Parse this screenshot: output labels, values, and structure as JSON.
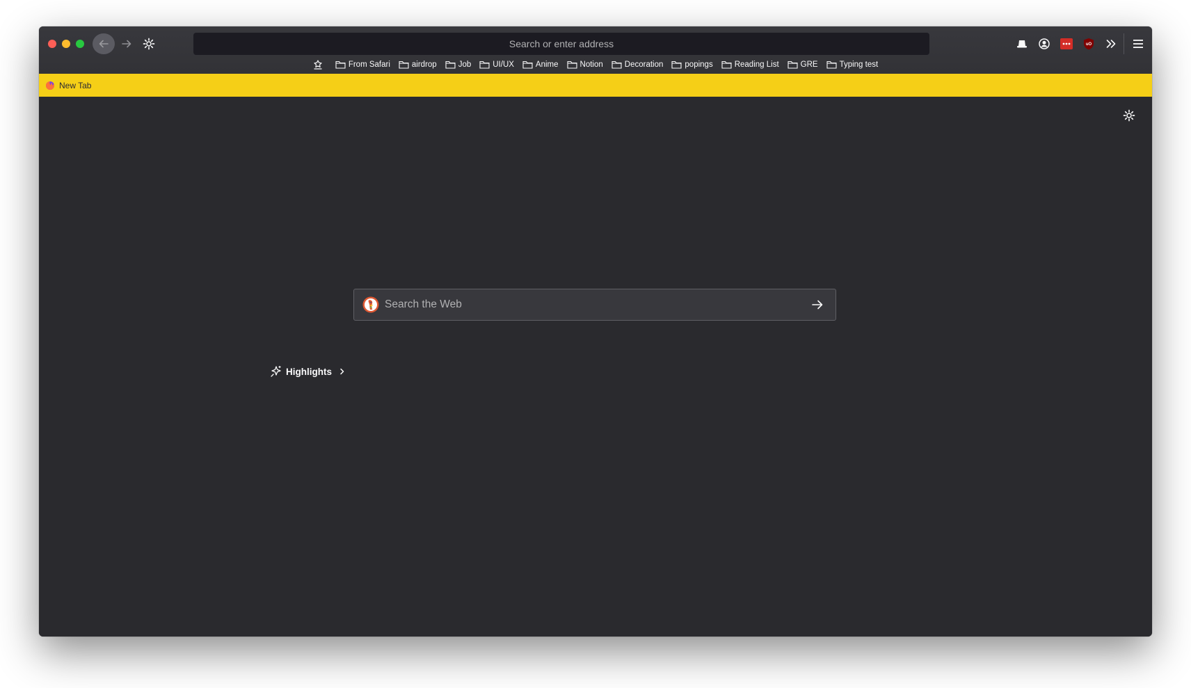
{
  "window": {
    "controls": [
      "close",
      "minimize",
      "maximize"
    ],
    "colors": {
      "close": "#fe5f57",
      "minimize": "#febc2e",
      "maximize": "#28c840"
    }
  },
  "toolbar": {
    "address_placeholder": "Search or enter address",
    "icons": [
      "back-arrow-icon",
      "forward-arrow-icon",
      "gear-icon",
      "hat-icon",
      "account-icon",
      "lastpass-icon",
      "ublock-icon",
      "overflow-chevrons-icon",
      "hamburger-menu-icon"
    ]
  },
  "bookmarks": {
    "items": [
      {
        "label": "From Safari"
      },
      {
        "label": "airdrop"
      },
      {
        "label": "Job"
      },
      {
        "label": "UI/UX"
      },
      {
        "label": "Anime"
      },
      {
        "label": "Notion"
      },
      {
        "label": "Decoration"
      },
      {
        "label": "popings"
      },
      {
        "label": "Reading List"
      },
      {
        "label": "GRE"
      },
      {
        "label": "Typing test"
      }
    ]
  },
  "tabs": [
    {
      "label": "New Tab",
      "active": true
    }
  ],
  "theme": {
    "tab_bar_color": "#f5cf17",
    "content_bg": "#2a2a2e"
  },
  "main": {
    "search_placeholder": "Search the Web",
    "search_engine_icon": "duckduckgo-logo-icon",
    "highlights_label": "Highlights"
  }
}
